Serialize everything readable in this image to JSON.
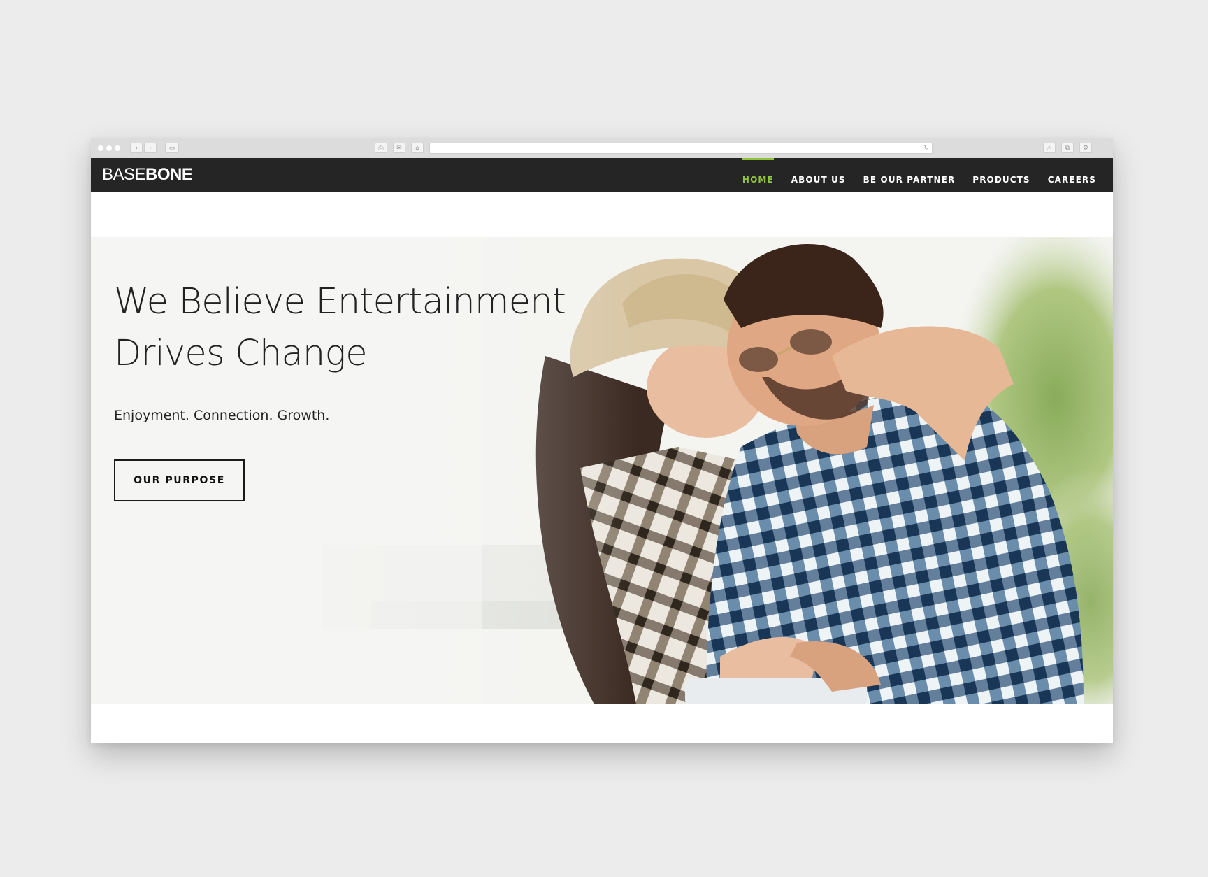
{
  "chrome": {
    "back_glyph": "‹",
    "forward_glyph": "›",
    "sidebar_glyph": "▭",
    "print_glyph": "⎙",
    "mail_glyph": "✉",
    "home_glyph": "⌂",
    "reload_glyph": "↻",
    "share_glyph": "△",
    "tabs_glyph": "⧉",
    "settings_glyph": "⚙"
  },
  "site": {
    "logo_light": "BASE",
    "logo_bold": "BONE"
  },
  "nav": {
    "items": [
      {
        "label": "HOME",
        "active": true
      },
      {
        "label": "ABOUT US",
        "active": false
      },
      {
        "label": "BE OUR PARTNER",
        "active": false
      },
      {
        "label": "PRODUCTS",
        "active": false
      },
      {
        "label": "CAREERS",
        "active": false
      }
    ],
    "active_color": "#8fc43f"
  },
  "hero": {
    "headline_line1": "We Believe Entertainment",
    "headline_line2": "Drives Change",
    "tagline": "Enjoyment. Connection. Growth.",
    "cta_label": "OUR PURPOSE"
  },
  "colors": {
    "page_bg": "#ececec",
    "nav_bg": "#252525",
    "accent": "#8fc43f",
    "text": "#222222"
  }
}
